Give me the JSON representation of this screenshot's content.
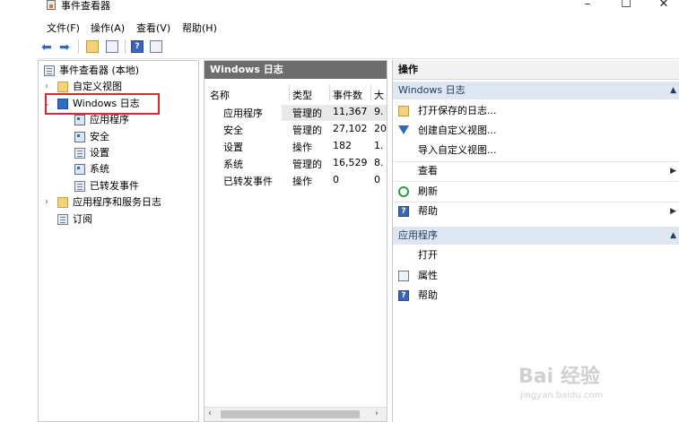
{
  "window": {
    "title": "事件查看器",
    "minimize": "–",
    "maximize": "☐",
    "close": "✕"
  },
  "menu": [
    "文件(F)",
    "操作(A)",
    "查看(V)",
    "帮助(H)"
  ],
  "tree": {
    "root": "事件查看器 (本地)",
    "custom_views": "自定义视图",
    "windows_logs": "Windows 日志",
    "children": [
      "应用程序",
      "安全",
      "设置",
      "系统",
      "已转发事件"
    ],
    "app_service_logs": "应用程序和服务日志",
    "subscriptions": "订阅"
  },
  "middle": {
    "header": "Windows 日志",
    "columns": [
      "名称",
      "类型",
      "事件数",
      "大"
    ],
    "rows": [
      {
        "name": "应用程序",
        "type": "管理的",
        "count": "11,367",
        "size": "9."
      },
      {
        "name": "安全",
        "type": "管理的",
        "count": "27,102",
        "size": "20"
      },
      {
        "name": "设置",
        "type": "操作",
        "count": "182",
        "size": "1."
      },
      {
        "name": "系统",
        "type": "管理的",
        "count": "16,529",
        "size": "8."
      },
      {
        "name": "已转发事件",
        "type": "操作",
        "count": "0",
        "size": "0"
      }
    ]
  },
  "actions": {
    "header": "操作",
    "section1": "Windows 日志",
    "items1": [
      "打开保存的日志...",
      "创建自定义视图...",
      "导入自定义视图...",
      "查看",
      "刷新",
      "帮助"
    ],
    "section2": "应用程序",
    "items2": [
      "打开",
      "属性",
      "帮助"
    ]
  },
  "icons": {
    "back": "arrow-left-icon",
    "forward": "arrow-right-icon",
    "help_glyph": "?"
  },
  "watermark": {
    "main": "Bai 经验",
    "sub": "jingyan.baidu.com"
  },
  "colors": {
    "highlight_border": "#e0252b",
    "section_bg": "#dde6f1",
    "middle_header_bg": "#6d6d6d"
  }
}
